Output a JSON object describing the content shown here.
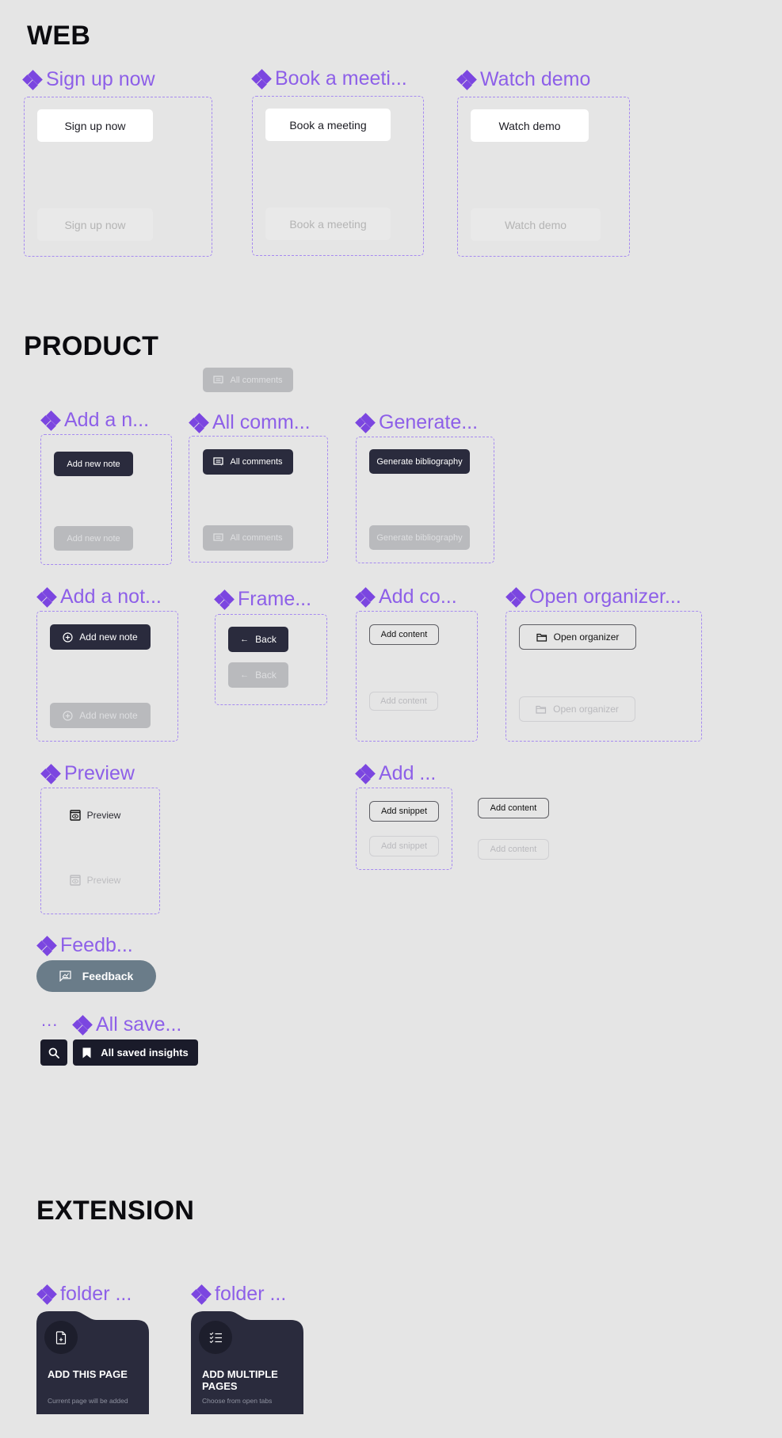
{
  "sections": {
    "web": "WEB",
    "product": "PRODUCT",
    "extension": "EXTENSION"
  },
  "web": {
    "components": [
      {
        "label": "Sign up now",
        "button": "Sign up now",
        "disabled_button": "Sign up now"
      },
      {
        "label": "Book a meeti...",
        "button": "Book a meeting",
        "disabled_button": "Book a meeting"
      },
      {
        "label": "Watch demo",
        "button": "Watch demo",
        "disabled_button": "Watch demo"
      }
    ]
  },
  "product": {
    "floating_all_comments": {
      "label": "All comments",
      "icon": "comment-icon"
    },
    "add_note": {
      "label": "Add a n...",
      "button": "Add new note",
      "disabled_button": "Add new note"
    },
    "all_comments": {
      "label": "All comm...",
      "button": "All comments",
      "disabled_button": "All comments",
      "icon": "comment-icon"
    },
    "generate": {
      "label": "Generate...",
      "button": "Generate bibliography",
      "disabled_button": "Generate bibliography"
    },
    "add_note_icon": {
      "label": "Add a not...",
      "button": "Add new note",
      "disabled_button": "Add new note",
      "icon": "plus-circle-icon"
    },
    "frame_back": {
      "label": "Frame...",
      "button": "Back",
      "disabled_button": "Back",
      "icon": "arrow-left-icon"
    },
    "add_content": {
      "label": "Add co...",
      "button": "Add content",
      "disabled_button": "Add content"
    },
    "open_organizer": {
      "label": "Open organizer...",
      "button": "Open organizer",
      "disabled_button": "Open organizer",
      "icon": "folder-icon"
    },
    "preview": {
      "label": "Preview",
      "button": "Preview",
      "disabled_button": "Preview",
      "icon": "eye-window-icon"
    },
    "add_snippet": {
      "label": "Add ...",
      "button": "Add snippet",
      "disabled_button": "Add snippet"
    },
    "loose_add_content": {
      "button": "Add content",
      "disabled_button": "Add content"
    },
    "feedback": {
      "label": "Feedb...",
      "button": "Feedback",
      "icon": "feedback-icon"
    },
    "search": {
      "label": "...",
      "icon": "search-icon"
    },
    "saved": {
      "label": "All save...",
      "button": "All saved insights",
      "icon": "bookmark-icon"
    }
  },
  "extension": {
    "cards": [
      {
        "label": "folder ...",
        "title": "ADD THIS PAGE",
        "subtitle": "Current page will be added",
        "icon": "file-add-icon"
      },
      {
        "label": "folder ...",
        "title": "ADD MULTIPLE PAGES",
        "subtitle": "Choose from open tabs",
        "icon": "checklist-icon"
      }
    ]
  },
  "colors": {
    "background": "#e5e5e5",
    "accent_purple": "#7b46e0",
    "dark_button": "#2a2b3d",
    "feedback_button": "#6a7c89",
    "card": "#2a2b3d"
  }
}
